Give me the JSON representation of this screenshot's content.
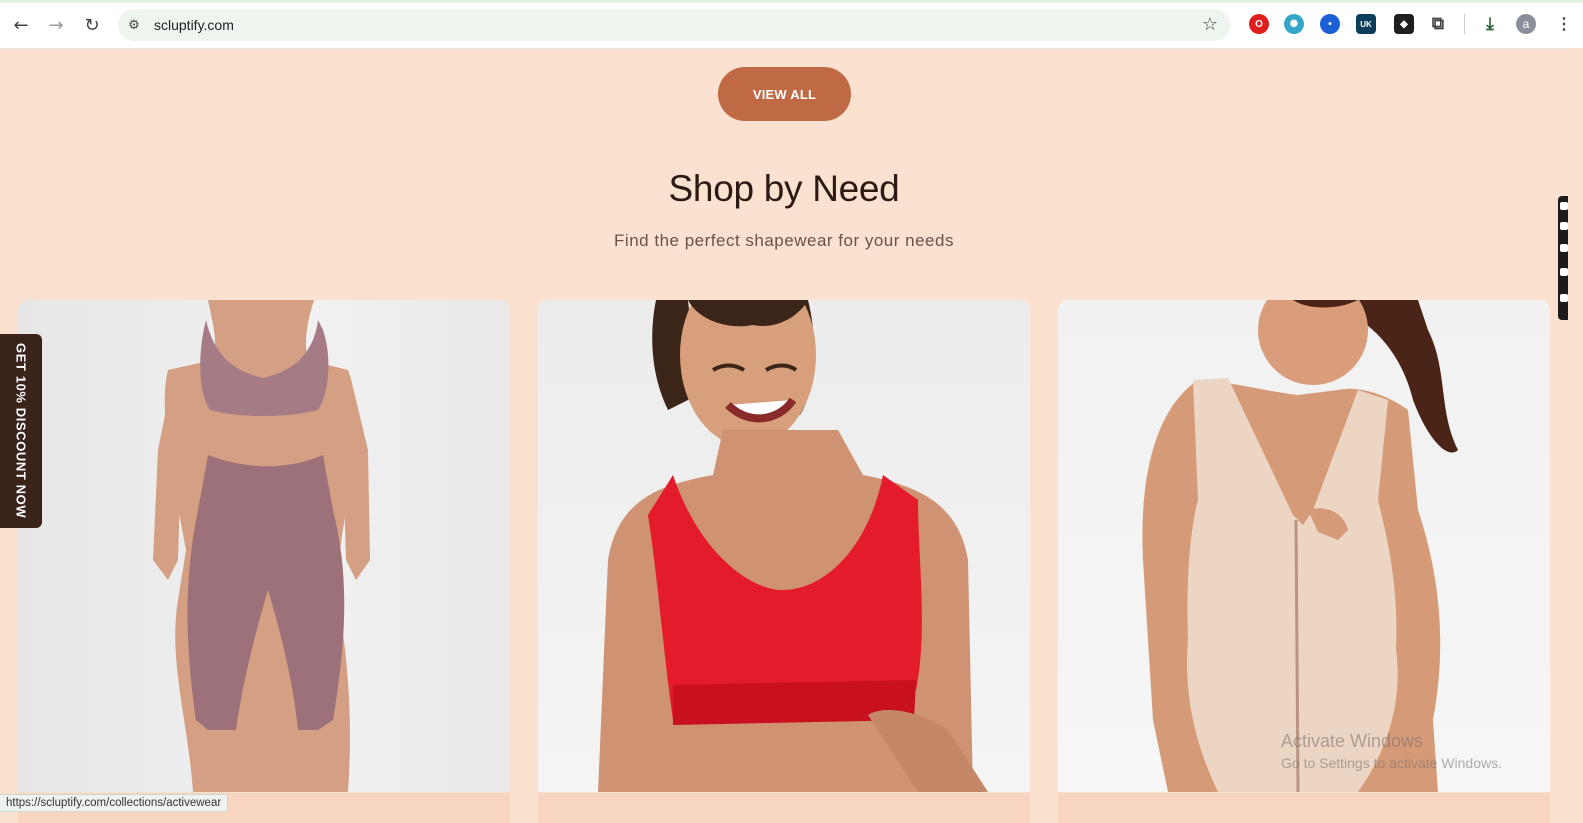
{
  "browser": {
    "url": "scluptify.com",
    "status_url": "https://scluptify.com/collections/activewear",
    "profile_initial": "a",
    "extension_badge": "UK"
  },
  "page": {
    "view_all_label": "VIEW ALL",
    "section_title": "Shop by Need",
    "section_subtitle": "Find the perfect shapewear for your needs",
    "discount_tab_label": "GET 10% DISCOUNT NOW",
    "colors": {
      "background": "#fbe1d0",
      "button": "#c06a45",
      "title": "#2d1a12",
      "discount_tab": "#3a241a"
    }
  },
  "cards": [
    {
      "image": "model-activewear-set",
      "href": "https://scluptify.com/collections/activewear"
    },
    {
      "image": "model-red-sports-bra"
    },
    {
      "image": "model-beige-bodysuit"
    }
  ],
  "os_watermark": {
    "line1": "Activate Windows",
    "line2": "Go to Settings to activate Windows."
  }
}
